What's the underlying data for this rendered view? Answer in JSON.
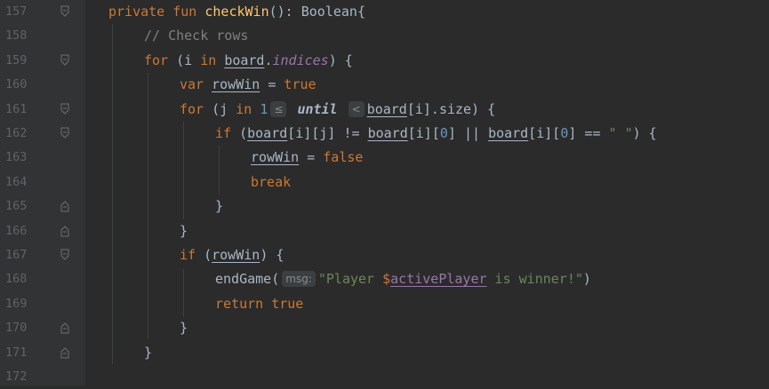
{
  "line_numbers": [
    "157",
    "158",
    "159",
    "160",
    "161",
    "162",
    "163",
    "164",
    "165",
    "166",
    "167",
    "168",
    "169",
    "170",
    "171",
    "172"
  ],
  "code": {
    "l157": {
      "kw1": "private",
      "kw2": "fun",
      "fn": "checkWin",
      "rest": "(): Boolean{"
    },
    "l158": {
      "comment": "// Check rows"
    },
    "l159": {
      "kw": "for",
      "p1": " (i ",
      "kw_in": "in",
      "sp": " ",
      "board": "board",
      "dot": ".",
      "prop": "indices",
      "rest": ") {"
    },
    "l160": {
      "kw": "var",
      "sp": " ",
      "var": "rowWin",
      "eq": " = ",
      "val": "true"
    },
    "l161": {
      "kw": "for",
      "p1": " (j ",
      "kw_in": "in",
      "sp": " ",
      "num": "1",
      "hint1": "≤",
      "until": "until",
      "hint2": "<",
      "board": "board",
      "rest": "[i].size) {"
    },
    "l162": {
      "kw": "if",
      "p1": " (",
      "b1": "board",
      "p2": "[i][j] != ",
      "b2": "board",
      "p3": "[i][",
      "n1": "0",
      "p4": "] || ",
      "b3": "board",
      "p5": "[i][",
      "n2": "0",
      "p6": "] == ",
      "str": "\" \"",
      "p7": ") {"
    },
    "l163": {
      "var": "rowWin",
      "eq": " = ",
      "val": "false"
    },
    "l164": {
      "kw": "break"
    },
    "l165": {
      "brace": "}"
    },
    "l166": {
      "brace": "}"
    },
    "l167": {
      "kw": "if",
      "p1": " (",
      "var": "rowWin",
      "p2": ") {"
    },
    "l168": {
      "fn": "endGame(",
      "hint": "msg:",
      "str1": "\"Player ",
      "dollar": "$",
      "ref": "activePlayer",
      "str2": " is winner!\"",
      "close": ")"
    },
    "l169": {
      "kw": "return",
      "sp": " ",
      "val": "true"
    },
    "l170": {
      "brace": "}"
    },
    "l171": {
      "brace": "}"
    }
  }
}
